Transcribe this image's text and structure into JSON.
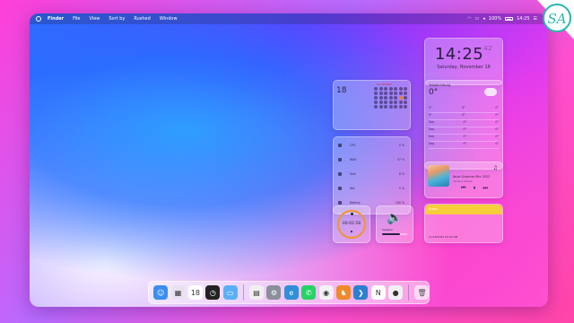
{
  "menubar": {
    "items": [
      "Finder",
      "File",
      "View",
      "Sort by",
      "Rushed",
      "Window"
    ],
    "battery": "100%",
    "clock": "14:25"
  },
  "clock_widget": {
    "time": "14:25",
    "seconds": "42",
    "date": "Saturday, November 18"
  },
  "calendar_widget": {
    "month": "NOVEMBER",
    "day": "18"
  },
  "weather_widget": {
    "city": "Yekaterinburg",
    "temp": "0°",
    "rows": [
      {
        "a": "0°",
        "b": "0°",
        "c": "0°"
      },
      {
        "a": "0°",
        "b": "0°",
        "c": "0°"
      },
      {
        "a": "Day",
        "b": "0°",
        "c": "0°"
      },
      {
        "a": "Day",
        "b": "0°",
        "c": "0°"
      },
      {
        "a": "Day",
        "b": "0°",
        "c": "0°"
      },
      {
        "a": "Day",
        "b": "0°",
        "c": "0°"
      }
    ]
  },
  "stats_widget": {
    "rows": [
      {
        "label": "CPU",
        "value": "0 %"
      },
      {
        "label": "RAM",
        "value": "37 %"
      },
      {
        "label": "Disk",
        "value": "8 %"
      },
      {
        "label": "Net",
        "value": "0 %"
      },
      {
        "label": "Battery",
        "value": "100 %"
      }
    ]
  },
  "music_widget": {
    "title": "Ibiza Summer Mix 2022",
    "artist": "Various Artists"
  },
  "notes_widget": {
    "header": "Notes",
    "timestamp": "11/18/2022 02:25 PM"
  },
  "timer_widget": {
    "time": "00:02:58"
  },
  "volume_widget": {
    "label": "Speaker",
    "level": 0.7
  },
  "dock": {
    "apps": [
      {
        "name": "finder",
        "color": "#3a8ef0",
        "glyph": "☺"
      },
      {
        "name": "launchpad",
        "color": "#e8e2f0",
        "glyph": "▦"
      },
      {
        "name": "calendar",
        "color": "#ffffff",
        "glyph": "18"
      },
      {
        "name": "clock",
        "color": "#222222",
        "glyph": "◷"
      },
      {
        "name": "folder",
        "color": "#5ab0f5",
        "glyph": "▭"
      },
      {
        "name": "taskmgr",
        "color": "#f0f0f0",
        "glyph": "▤"
      },
      {
        "name": "settings",
        "color": "#8a8f9a",
        "glyph": "⚙"
      },
      {
        "name": "edge",
        "color": "#2f8fd8",
        "glyph": "e"
      },
      {
        "name": "whatsapp",
        "color": "#25d366",
        "glyph": "✆"
      },
      {
        "name": "chrome",
        "color": "#f2f2f2",
        "glyph": "◉"
      },
      {
        "name": "game",
        "color": "#ef8a2a",
        "glyph": "♞"
      },
      {
        "name": "vscode",
        "color": "#2d7fd0",
        "glyph": "❯"
      },
      {
        "name": "notion",
        "color": "#ffffff",
        "glyph": "N"
      },
      {
        "name": "github",
        "color": "#f0f0f0",
        "glyph": "●"
      }
    ]
  }
}
